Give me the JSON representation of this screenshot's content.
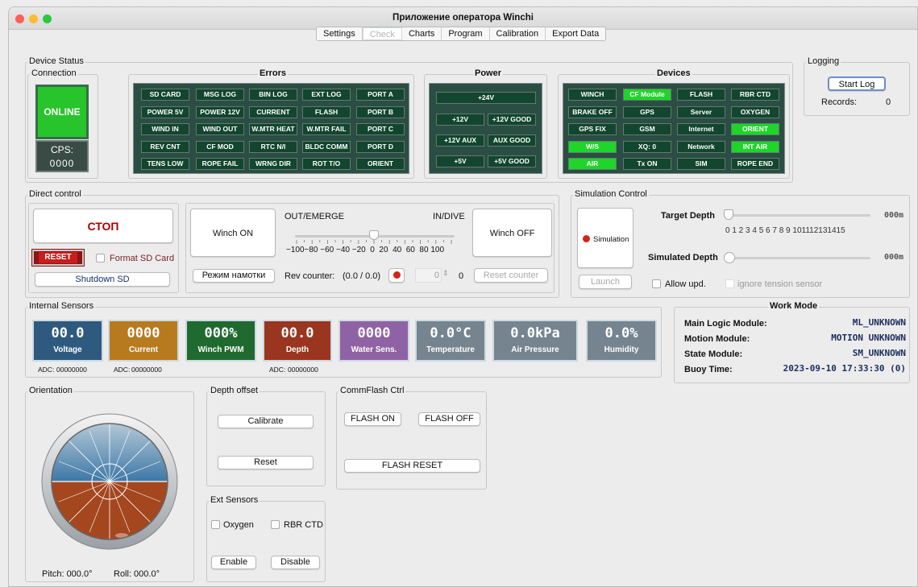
{
  "window": {
    "title": "Приложение оператора Winchi"
  },
  "tabs": [
    "Settings",
    "Check",
    "Charts",
    "Program",
    "Calibration",
    "Export Data"
  ],
  "device_status": {
    "title": "Device Status",
    "connection": {
      "title": "Connection",
      "online": "ONLINE",
      "cps_label": "CPS:",
      "cps_value": "0000"
    }
  },
  "errors": {
    "title": "Errors",
    "items": [
      "SD CARD",
      "MSG LOG",
      "BIN LOG",
      "EXT LOG",
      "PORT A",
      "POWER 5V",
      "POWER 12V",
      "CURRENT",
      "FLASH",
      "PORT B",
      "WIND IN",
      "WIND OUT",
      "W.MTR HEAT",
      "W.MTR FAIL",
      "PORT C",
      "REV CNT",
      "CF MOD",
      "RTC N/I",
      "BLDC COMM",
      "PORT D",
      "TENS LOW",
      "ROPE FAIL",
      "WRNG DIR",
      "ROT T/O",
      "ORIENT"
    ]
  },
  "power": {
    "title": "Power",
    "items": [
      "+24V",
      "+12V",
      "+12V GOOD",
      "+12V AUX",
      "AUX GOOD",
      "+5V",
      "+5V GOOD"
    ]
  },
  "devices": {
    "title": "Devices",
    "items": [
      {
        "t": "WINCH",
        "on": false
      },
      {
        "t": "CF Module",
        "on": true
      },
      {
        "t": "FLASH",
        "on": false
      },
      {
        "t": "RBR CTD",
        "on": false
      },
      {
        "t": "BRAKE OFF",
        "on": false
      },
      {
        "t": "GPS",
        "on": false
      },
      {
        "t": "Server",
        "on": false
      },
      {
        "t": "OXYGEN",
        "on": false
      },
      {
        "t": "GPS FIX",
        "on": false
      },
      {
        "t": "GSM",
        "on": false
      },
      {
        "t": "Internet",
        "on": false
      },
      {
        "t": "ORIENT",
        "on": true
      },
      {
        "t": "W/S",
        "on": true
      },
      {
        "t": "XQ: 0",
        "on": false
      },
      {
        "t": "Network",
        "on": false
      },
      {
        "t": "INT AIR",
        "on": true
      },
      {
        "t": "AIR",
        "on": true
      },
      {
        "t": "Tx ON",
        "on": false
      },
      {
        "t": "SIM",
        "on": false
      },
      {
        "t": "ROPE END",
        "on": false
      }
    ]
  },
  "logging": {
    "title": "Logging",
    "start": "Start Log",
    "records_label": "Records:",
    "records_value": "0"
  },
  "direct": {
    "title": "Direct control",
    "stop": "СТОП",
    "reset": "RESET",
    "format_sd": "Format SD Card",
    "shutdown": "Shutdown SD",
    "winch_on": "Winch ON",
    "winch_off": "Winch OFF",
    "out": "OUT/EMERGE",
    "in": "IN/DIVE",
    "ticks": "−100−80 −60 −40 −20  0  20  40  60  80 100",
    "mode": "Режим намотки",
    "rev_label": "Rev counter:",
    "rev_value": "(0.0 / 0.0)",
    "spin": "0",
    "spin2": "0",
    "reset_counter": "Reset counter"
  },
  "sim": {
    "title": "Simulation Control",
    "sim": "Simulation",
    "launch": "Launch",
    "target": "Target Depth",
    "target_val": "000m",
    "ticks": "0 1 2 3 4 5 6 7 8 9 101112131415",
    "simulated": "Simulated Depth",
    "simulated_val": "000m",
    "allow": "Allow upd.",
    "ignore": "ignore tension sensor"
  },
  "internal": {
    "title": "Internal Sensors",
    "items": [
      {
        "v": "00.0",
        "l": "Voltage",
        "c": "#2f5a7f"
      },
      {
        "v": "0000",
        "l": "Current",
        "c": "#b87a1f"
      },
      {
        "v": "000%",
        "l": "Winch PWM",
        "c": "#1f6a2f"
      },
      {
        "v": "00.0",
        "l": "Depth",
        "c": "#9a3520"
      },
      {
        "v": "0000",
        "l": "Water Sens.",
        "c": "#8f62a5"
      },
      {
        "v": "0.0°C",
        "l": "Temperature",
        "c": "#76848f"
      },
      {
        "v": "0.0kPa",
        "l": "Air Pressure",
        "c": "#76848f"
      },
      {
        "v": "0.0%",
        "l": "Humidity",
        "c": "#76848f"
      }
    ],
    "adc1": "ADC:",
    "adc1v": "00000000",
    "adc2": "ADC:",
    "adc2v": "00000000",
    "adc3": "ADC:",
    "adc3v": "00000000"
  },
  "work": {
    "title": "Work Mode",
    "rows": [
      {
        "k": "Main Logic Module:",
        "v": "ML_UNKNOWN"
      },
      {
        "k": "Motion Module:",
        "v": "MOTION UNKNOWN"
      },
      {
        "k": "State Module:",
        "v": "SM_UNKNOWN"
      },
      {
        "k": "Buoy Time:",
        "v": "2023-09-10 17:33:30 (0)"
      }
    ]
  },
  "orientation": {
    "title": "Orientation",
    "pitch": "Pitch:  000.0°",
    "roll": "Roll:  000.0°"
  },
  "depth": {
    "title": "Depth offset",
    "calibrate": "Calibrate",
    "reset": "Reset"
  },
  "comm": {
    "title": "CommFlash Ctrl",
    "on": "FLASH ON",
    "off": "FLASH OFF",
    "reset": "FLASH RESET"
  },
  "ext": {
    "title": "Ext Sensors",
    "oxygen": "Oxygen",
    "rbr": "RBR CTD",
    "enable": "Enable",
    "disable": "Disable"
  }
}
